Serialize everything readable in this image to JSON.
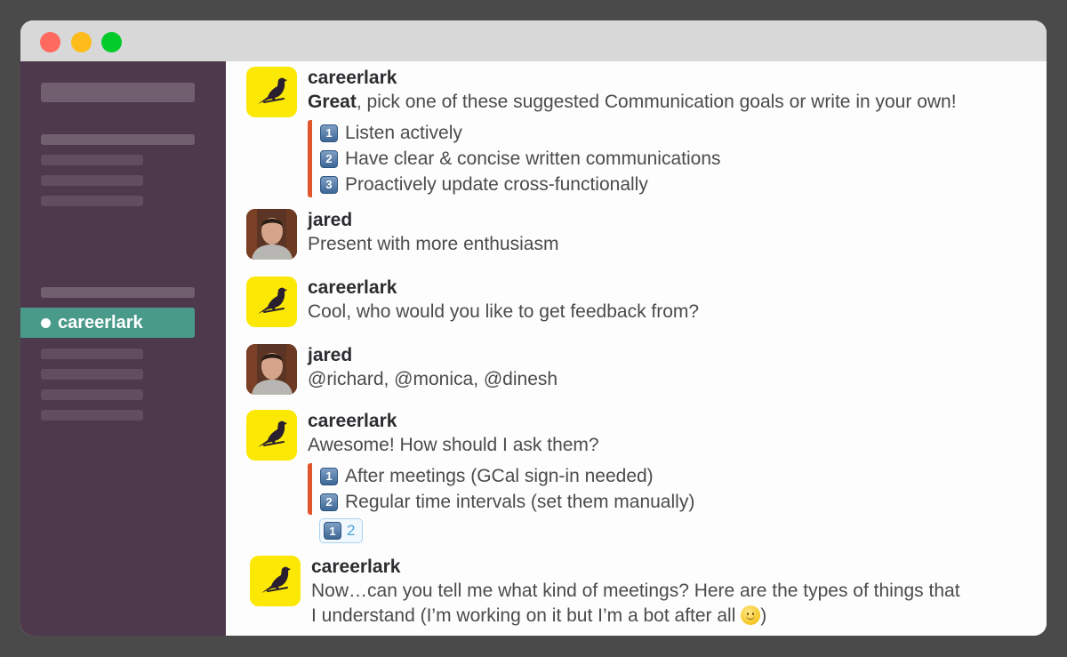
{
  "window": {
    "controls": [
      "close",
      "minimize",
      "zoom"
    ]
  },
  "sidebar": {
    "active_channel": {
      "label": "careerlark",
      "status": "online"
    },
    "placeholder_rows": 10
  },
  "messages": [
    {
      "author": "careerlark",
      "avatar": "bird-logo",
      "text_bold": "Great",
      "text": ", pick one of these suggested Communication goals or write in your own!",
      "options": [
        {
          "key": "1",
          "label": "Listen actively"
        },
        {
          "key": "2",
          "label": "Have clear & concise written communications"
        },
        {
          "key": "3",
          "label": "Proactively update cross-functionally"
        }
      ]
    },
    {
      "author": "jared",
      "avatar": "user-photo",
      "text": "Present with more enthusiasm"
    },
    {
      "author": "careerlark",
      "avatar": "bird-logo",
      "text": "Cool, who would you like to get feedback from?"
    },
    {
      "author": "jared",
      "avatar": "user-photo",
      "text": "@richard, @monica, @dinesh"
    },
    {
      "author": "careerlark",
      "avatar": "bird-logo",
      "text": "Awesome! How should I ask them?",
      "options": [
        {
          "key": "1",
          "label": "After meetings (GCal sign-in needed)"
        },
        {
          "key": "2",
          "label": "Regular time intervals (set them manually)"
        }
      ],
      "reaction": {
        "emoji": "1",
        "count": "2"
      }
    },
    {
      "author": "careerlark",
      "avatar": "bird-logo",
      "text_line1": "Now…can you tell me what kind of meetings? Here are the types of things that",
      "text_line2": "I understand (I’m working on it but I’m a bot after all ",
      "text_end": ")",
      "emoji": "slightly-smiling-face"
    }
  ],
  "colors": {
    "sidebar_bg": "#4d394b",
    "active_channel": "#4a9a8a",
    "attachment_bar": "#e0562b",
    "bot_avatar_bg": "#fbe805",
    "reaction_border": "#a9d3ef",
    "reaction_text": "#4aa3df"
  }
}
